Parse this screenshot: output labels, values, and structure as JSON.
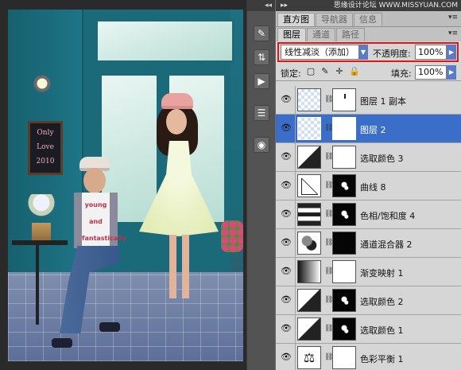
{
  "panel": {
    "watermark": "思缘设计论坛 WWW.MISSYUAN.COM",
    "tabs_top": [
      {
        "label": "直方图"
      },
      {
        "label": "导航器"
      },
      {
        "label": "信息"
      }
    ],
    "tabs_main": [
      {
        "label": "图层"
      },
      {
        "label": "通道"
      },
      {
        "label": "路径"
      }
    ],
    "blend_mode": "线性减淡（添加）",
    "opacity_label": "不透明度:",
    "opacity_value": "100%",
    "lock_label": "锁定:",
    "fill_label": "填充:",
    "fill_value": "100%"
  },
  "photo": {
    "chalkboard_text": [
      "Only",
      "Love",
      "2010"
    ],
    "shirt_text": [
      "young",
      "and",
      "fantastically",
      "bored"
    ]
  },
  "layers": [
    {
      "name": "图层 1 副本",
      "selected": false
    },
    {
      "name": "图层 2",
      "selected": true
    },
    {
      "name": "选取颜色 3",
      "selected": false
    },
    {
      "name": "曲线 8",
      "selected": false
    },
    {
      "name": "色相/饱和度 4",
      "selected": false
    },
    {
      "name": "通道混合器 2",
      "selected": false
    },
    {
      "name": "渐变映射 1",
      "selected": false
    },
    {
      "name": "选取颜色 2",
      "selected": false
    },
    {
      "name": "选取颜色 1",
      "selected": false
    },
    {
      "name": "色彩平衡 1",
      "selected": false
    }
  ],
  "colors": {
    "selection": "#3b6ec8",
    "highlight_box": "#e01616",
    "panel_bg": "#d6d6d6"
  }
}
